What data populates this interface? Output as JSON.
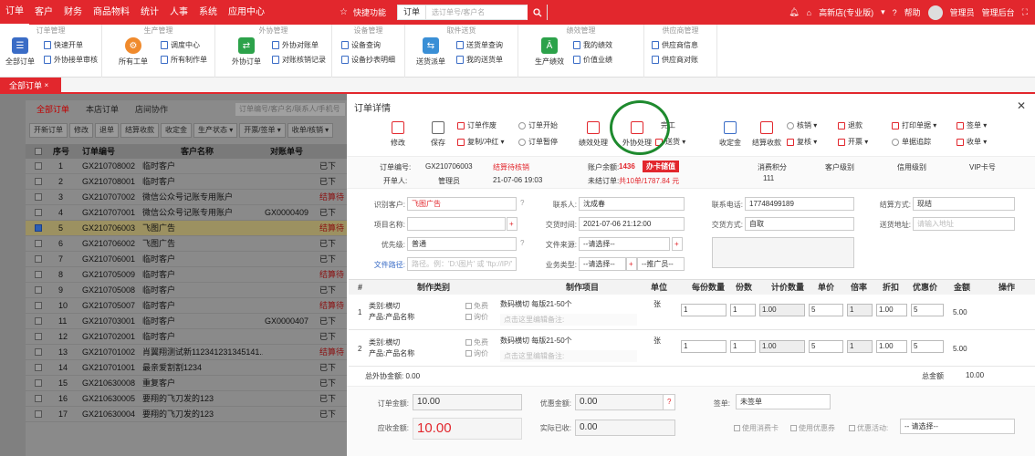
{
  "topnav": {
    "items": [
      "订单",
      "客户",
      "财务",
      "商品物料",
      "统计",
      "人事",
      "系统",
      "应用中心"
    ],
    "quick": "快捷功能",
    "order_sel": "订单",
    "search_placeholder": "选订单号/客户名",
    "store": "高新店(专业版)",
    "help": "帮助",
    "admin": "管理员",
    "backend": "管理后台"
  },
  "ribbon": {
    "groups": [
      {
        "title": "订单管理"
      },
      {
        "title": "生产管理"
      },
      {
        "title": "外协管理"
      },
      {
        "title": "设备管理"
      },
      {
        "title": "取件送货"
      },
      {
        "title": "绩效管理"
      },
      {
        "title": "供应商管理"
      }
    ],
    "all_orders": "全部订单",
    "quick_order": "快速开单",
    "outsource_audit": "外协接单审核",
    "all_work": "所有工单",
    "dispatch": "调度中心",
    "all_make": "所有制作单",
    "outsource_order": "外协订单",
    "outsource_bill": "外协对账单",
    "reconcile": "对账核销记录",
    "device_query": "设备查询",
    "device_report": "设备抄表明细",
    "delivery": "送货派单",
    "delivery_query": "送货单查询",
    "my_delivery": "我的送货单",
    "perf": "生产绩效",
    "my_perf": "我的绩效",
    "value": "价值业绩",
    "supplier_info": "供应商信息",
    "supplier_bill": "供应商对账"
  },
  "tab": {
    "label": "全部订单"
  },
  "left": {
    "tabs": [
      "全部订单",
      "本店订单",
      "店间协作"
    ],
    "search": "订单编号/客户名/联系人/手机号",
    "tools": [
      "开新订单",
      "修改",
      "退单",
      "结算收款",
      "收定金",
      "生产状态 ▾",
      "开票/签单 ▾",
      "收单/核销 ▾"
    ],
    "headers": {
      "no": "序号",
      "order": "订单编号",
      "customer": "客户名称",
      "account": "对账单号",
      "status": "状态"
    },
    "rows": [
      {
        "n": "1",
        "order": "GX210708002",
        "customer": "临时客户",
        "account": "",
        "status": "已下"
      },
      {
        "n": "2",
        "order": "GX210708001",
        "customer": "临时客户",
        "account": "",
        "status": "已下"
      },
      {
        "n": "3",
        "order": "GX210707002",
        "customer": "微信公众号记账专用账户",
        "account": "",
        "status": "结算待"
      },
      {
        "n": "4",
        "order": "GX210707001",
        "customer": "微信公众号记账专用账户",
        "account": "GX0000409",
        "status": "已下"
      },
      {
        "n": "5",
        "order": "GX210706003",
        "customer": "飞图广告",
        "account": "",
        "status": "结算待"
      },
      {
        "n": "6",
        "order": "GX210706002",
        "customer": "飞图广告",
        "account": "",
        "status": "已下"
      },
      {
        "n": "7",
        "order": "GX210706001",
        "customer": "临时客户",
        "account": "",
        "status": "已下"
      },
      {
        "n": "8",
        "order": "GX210705009",
        "customer": "临时客户",
        "account": "",
        "status": "结算待"
      },
      {
        "n": "9",
        "order": "GX210705008",
        "customer": "临时客户",
        "account": "",
        "status": "已下"
      },
      {
        "n": "10",
        "order": "GX210705007",
        "customer": "临时客户",
        "account": "",
        "status": "结算待"
      },
      {
        "n": "11",
        "order": "GX210703001",
        "customer": "临时客户",
        "account": "GX0000407",
        "status": "已下"
      },
      {
        "n": "12",
        "order": "GX210702001",
        "customer": "临时客户",
        "account": "",
        "status": "已下"
      },
      {
        "n": "13",
        "order": "GX210701002",
        "customer": "肖翼翔测试新112341231345141...",
        "account": "",
        "status": "结算待"
      },
      {
        "n": "14",
        "order": "GX210701001",
        "customer": "最亲爱割割1234",
        "account": "",
        "status": "已下"
      },
      {
        "n": "15",
        "order": "GX210630008",
        "customer": "重复客户",
        "account": "",
        "status": "已下"
      },
      {
        "n": "16",
        "order": "GX210630005",
        "customer": "要翔的飞刀发的123",
        "account": "",
        "status": "已下"
      },
      {
        "n": "17",
        "order": "GX210630004",
        "customer": "要翔的飞刀发的123",
        "account": "",
        "status": "已下"
      }
    ]
  },
  "modal": {
    "title": "订单详情",
    "toolbar": {
      "edit": "修改",
      "save": "保存",
      "order_void": "订单作废",
      "copy": "复制/冲红 ▾",
      "start": "订单开始",
      "pause": "订单暂停",
      "perf": "绩效处理",
      "outsource": "外协处理",
      "finish": "完工",
      "deliver": "送货 ▾",
      "deposit": "收定金",
      "settle": "结算收款",
      "writeoff": "核销 ▾",
      "review": "复核 ▾",
      "refund": "退款",
      "invoice": "开票 ▾",
      "print": "打印单据 ▾",
      "sign": "签单 ▾",
      "track": "单据追踪",
      "receipt": "收单 ▾"
    },
    "info": {
      "order_no_label": "订单编号:",
      "order_no": "GX210706003",
      "status": "结算待核销",
      "balance_label": "账户余额:",
      "balance": "1436",
      "card_btn": "办卡储值",
      "creator_label": "开单人:",
      "creator": "管理员",
      "time": "21-07-06 19:03",
      "unsettled_label": "未结订单:",
      "unsettled": "共10单/1787.84 元",
      "points_label": "消费积分",
      "points": "111",
      "cust_level": "客户级别",
      "credit_level": "信用级别",
      "vip": "VIP卡号"
    },
    "form": {
      "customer_label": "识别客户:",
      "customer": "飞图广告",
      "contact_label": "联系人:",
      "contact": "沈成春",
      "phone_label": "联系电话:",
      "phone": "17748499189",
      "settle_label": "结算方式:",
      "settle": "现结",
      "project_label": "项目名称:",
      "time_label": "交货时间:",
      "time": "2021-07-06 21:12:00",
      "delivery_label": "交货方式:",
      "delivery": "自取",
      "addr_label": "送货地址:",
      "addr_ph": "请输入地址",
      "priority_label": "优先级:",
      "priority": "普通",
      "source_label": "文件来源:",
      "source": "--请选择--",
      "req_label": "客户要求:",
      "path_label": "文件路径:",
      "path_ph": "路径。例：'D:\\图片' 或 'ftp://IP/'",
      "biz_label": "业务类型:",
      "biz": "--请选择--",
      "promo": "--推广员--"
    },
    "grid": {
      "headers": [
        "#",
        "制作类别",
        "制作项目",
        "单位",
        "每份数量",
        "份数",
        "计价数量",
        "单价",
        "倍率",
        "折扣",
        "优惠价",
        "金额",
        "操作"
      ],
      "rows": [
        {
          "n": "1",
          "cat1": "类别:横切",
          "cat2": "产品:产品名称",
          "free": "免费",
          "quote": "询价",
          "item": "数码横切 每版21-50个",
          "note": "点击这里编辑备注:",
          "unit": "张",
          "per": "1",
          "copies": "1",
          "qty": "1.00",
          "price": "5",
          "rate": "1",
          "disc": "1.00",
          "promo": "5",
          "amount": "5.00"
        },
        {
          "n": "2",
          "cat1": "类别:横切",
          "cat2": "产品:产品名称",
          "free": "免费",
          "quote": "询价",
          "item": "数码横切 每版21-50个",
          "note": "点击这里编辑备注:",
          "unit": "张",
          "per": "1",
          "copies": "1",
          "qty": "1.00",
          "price": "5",
          "rate": "1",
          "disc": "1.00",
          "promo": "5",
          "amount": "5.00"
        }
      ],
      "outsource_total": "总外协金额: 0.00",
      "total_label": "总金额",
      "total": "10.00"
    },
    "footer": {
      "order_amt_label": "订单金额:",
      "order_amt": "10.00",
      "discount_label": "优惠金额:",
      "discount": "0.00",
      "receivable_label": "应收金额:",
      "receivable": "10.00",
      "received_label": "实际已收:",
      "received": "0.00",
      "sign_label": "签单:",
      "sign": "未签单",
      "coupon1": "使用消费卡",
      "coupon2": "使用优惠券",
      "activity": "优惠活动:",
      "activity_sel": "-- 请选择--"
    }
  }
}
